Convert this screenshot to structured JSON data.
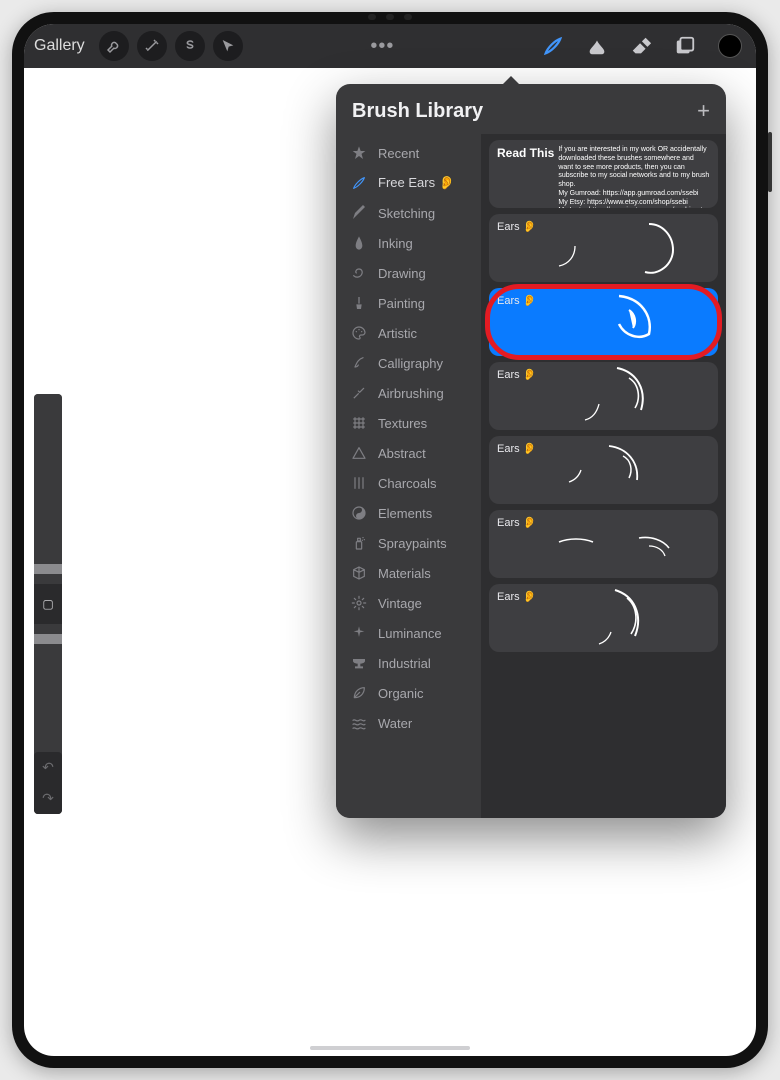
{
  "toolbar": {
    "gallery_label": "Gallery"
  },
  "sidebar": {
    "mid_button_glyph": "▢"
  },
  "popover": {
    "title": "Brush Library",
    "add_glyph": "+",
    "categories": [
      {
        "id": "recent",
        "label": "Recent",
        "icon": "star"
      },
      {
        "id": "free-ears",
        "label": "Free Ears 👂",
        "icon": "brush",
        "active": true
      },
      {
        "id": "sketching",
        "label": "Sketching",
        "icon": "pencil"
      },
      {
        "id": "inking",
        "label": "Inking",
        "icon": "nib"
      },
      {
        "id": "drawing",
        "label": "Drawing",
        "icon": "swirl"
      },
      {
        "id": "painting",
        "label": "Painting",
        "icon": "paintbrush"
      },
      {
        "id": "artistic",
        "label": "Artistic",
        "icon": "palette"
      },
      {
        "id": "calligraphy",
        "label": "Calligraphy",
        "icon": "calligraphy"
      },
      {
        "id": "airbrushing",
        "label": "Airbrushing",
        "icon": "airbrush"
      },
      {
        "id": "textures",
        "label": "Textures",
        "icon": "texture"
      },
      {
        "id": "abstract",
        "label": "Abstract",
        "icon": "triangle"
      },
      {
        "id": "charcoals",
        "label": "Charcoals",
        "icon": "charcoal"
      },
      {
        "id": "elements",
        "label": "Elements",
        "icon": "yinyang"
      },
      {
        "id": "spraypaints",
        "label": "Spraypaints",
        "icon": "spray"
      },
      {
        "id": "materials",
        "label": "Materials",
        "icon": "cube"
      },
      {
        "id": "vintage",
        "label": "Vintage",
        "icon": "vintage"
      },
      {
        "id": "luminance",
        "label": "Luminance",
        "icon": "sparkle"
      },
      {
        "id": "industrial",
        "label": "Industrial",
        "icon": "anvil"
      },
      {
        "id": "organic",
        "label": "Organic",
        "icon": "leaf"
      },
      {
        "id": "water",
        "label": "Water",
        "icon": "water"
      }
    ],
    "brushes": [
      {
        "label": "Read This",
        "readthis": true,
        "body": "If you are interested in my work OR accidentally downloaded these brushes somewhere and want to see more products, then you can subscribe to my social networks and to my brush shop.\nMy Gumroad: https://app.gumroad.com/ssebi\nMy Etsy: https://www.etsy.com/shop/ssebi\nMy Insta: https://www.instagram.com/ssebi_art\nplease subscribe ♥"
      },
      {
        "label": "Ears 👂"
      },
      {
        "label": "Ears 👂",
        "selected": true,
        "annotated": true
      },
      {
        "label": "Ears 👂"
      },
      {
        "label": "Ears 👂"
      },
      {
        "label": "Ears 👂"
      },
      {
        "label": "Ears 👂"
      }
    ]
  }
}
